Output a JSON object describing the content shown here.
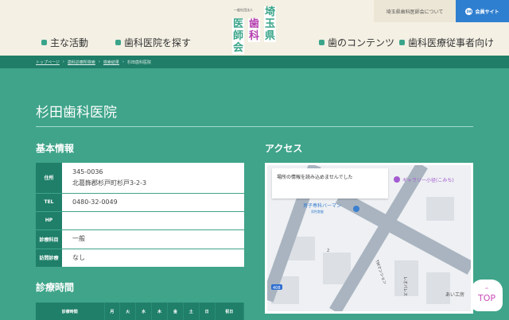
{
  "header": {
    "nav_left": [
      "主な活動",
      "歯科医院を探す"
    ],
    "nav_right": [
      "歯のコンテンツ",
      "歯科医療従事者向け"
    ],
    "logo": {
      "small": "一般社団法人",
      "col1": "医師会",
      "col2": "歯科",
      "col3": "埼玉県"
    },
    "about_link": "埼玉県歯科医師会について",
    "member_site": "会員サイト",
    "member_icon": "DN",
    "colors": {
      "accent": "#3aa58a",
      "member": "#2f7fd0"
    }
  },
  "breadcrumb": [
    "トップページ",
    "歯科診療所検索",
    "検索結果",
    "杉田歯科医院"
  ],
  "page_title": "杉田歯科医院",
  "basic": {
    "heading": "基本情報",
    "rows": [
      {
        "label": "住所",
        "lines": [
          "345-0036",
          "北葛飾郡杉戸町杉戸3-2-3"
        ]
      },
      {
        "label": "TEL",
        "lines": [
          "0480-32-0049"
        ]
      },
      {
        "label": "HP",
        "lines": [
          ""
        ]
      },
      {
        "label": "診療科目",
        "lines": [
          "一般"
        ]
      },
      {
        "label": "訪問診療",
        "lines": [
          "なし"
        ]
      }
    ]
  },
  "access": {
    "heading": "アクセス",
    "map_error": "場所の情報を読み込めませんでした",
    "labels": {
      "poi1": "ギャラリー小径(こみち)",
      "poi2": "男子専科バーマン",
      "poi2_sub": "男性散髪",
      "block": "2",
      "bldg1": "TMマンション",
      "bldg2": "レオパレス",
      "route": "408",
      "poi3": "あい工房"
    }
  },
  "hours": {
    "heading": "診療時間",
    "columns": [
      "診療時間",
      "月",
      "火",
      "水",
      "木",
      "金",
      "土",
      "日",
      "祝日"
    ]
  },
  "top_button": "TOP"
}
